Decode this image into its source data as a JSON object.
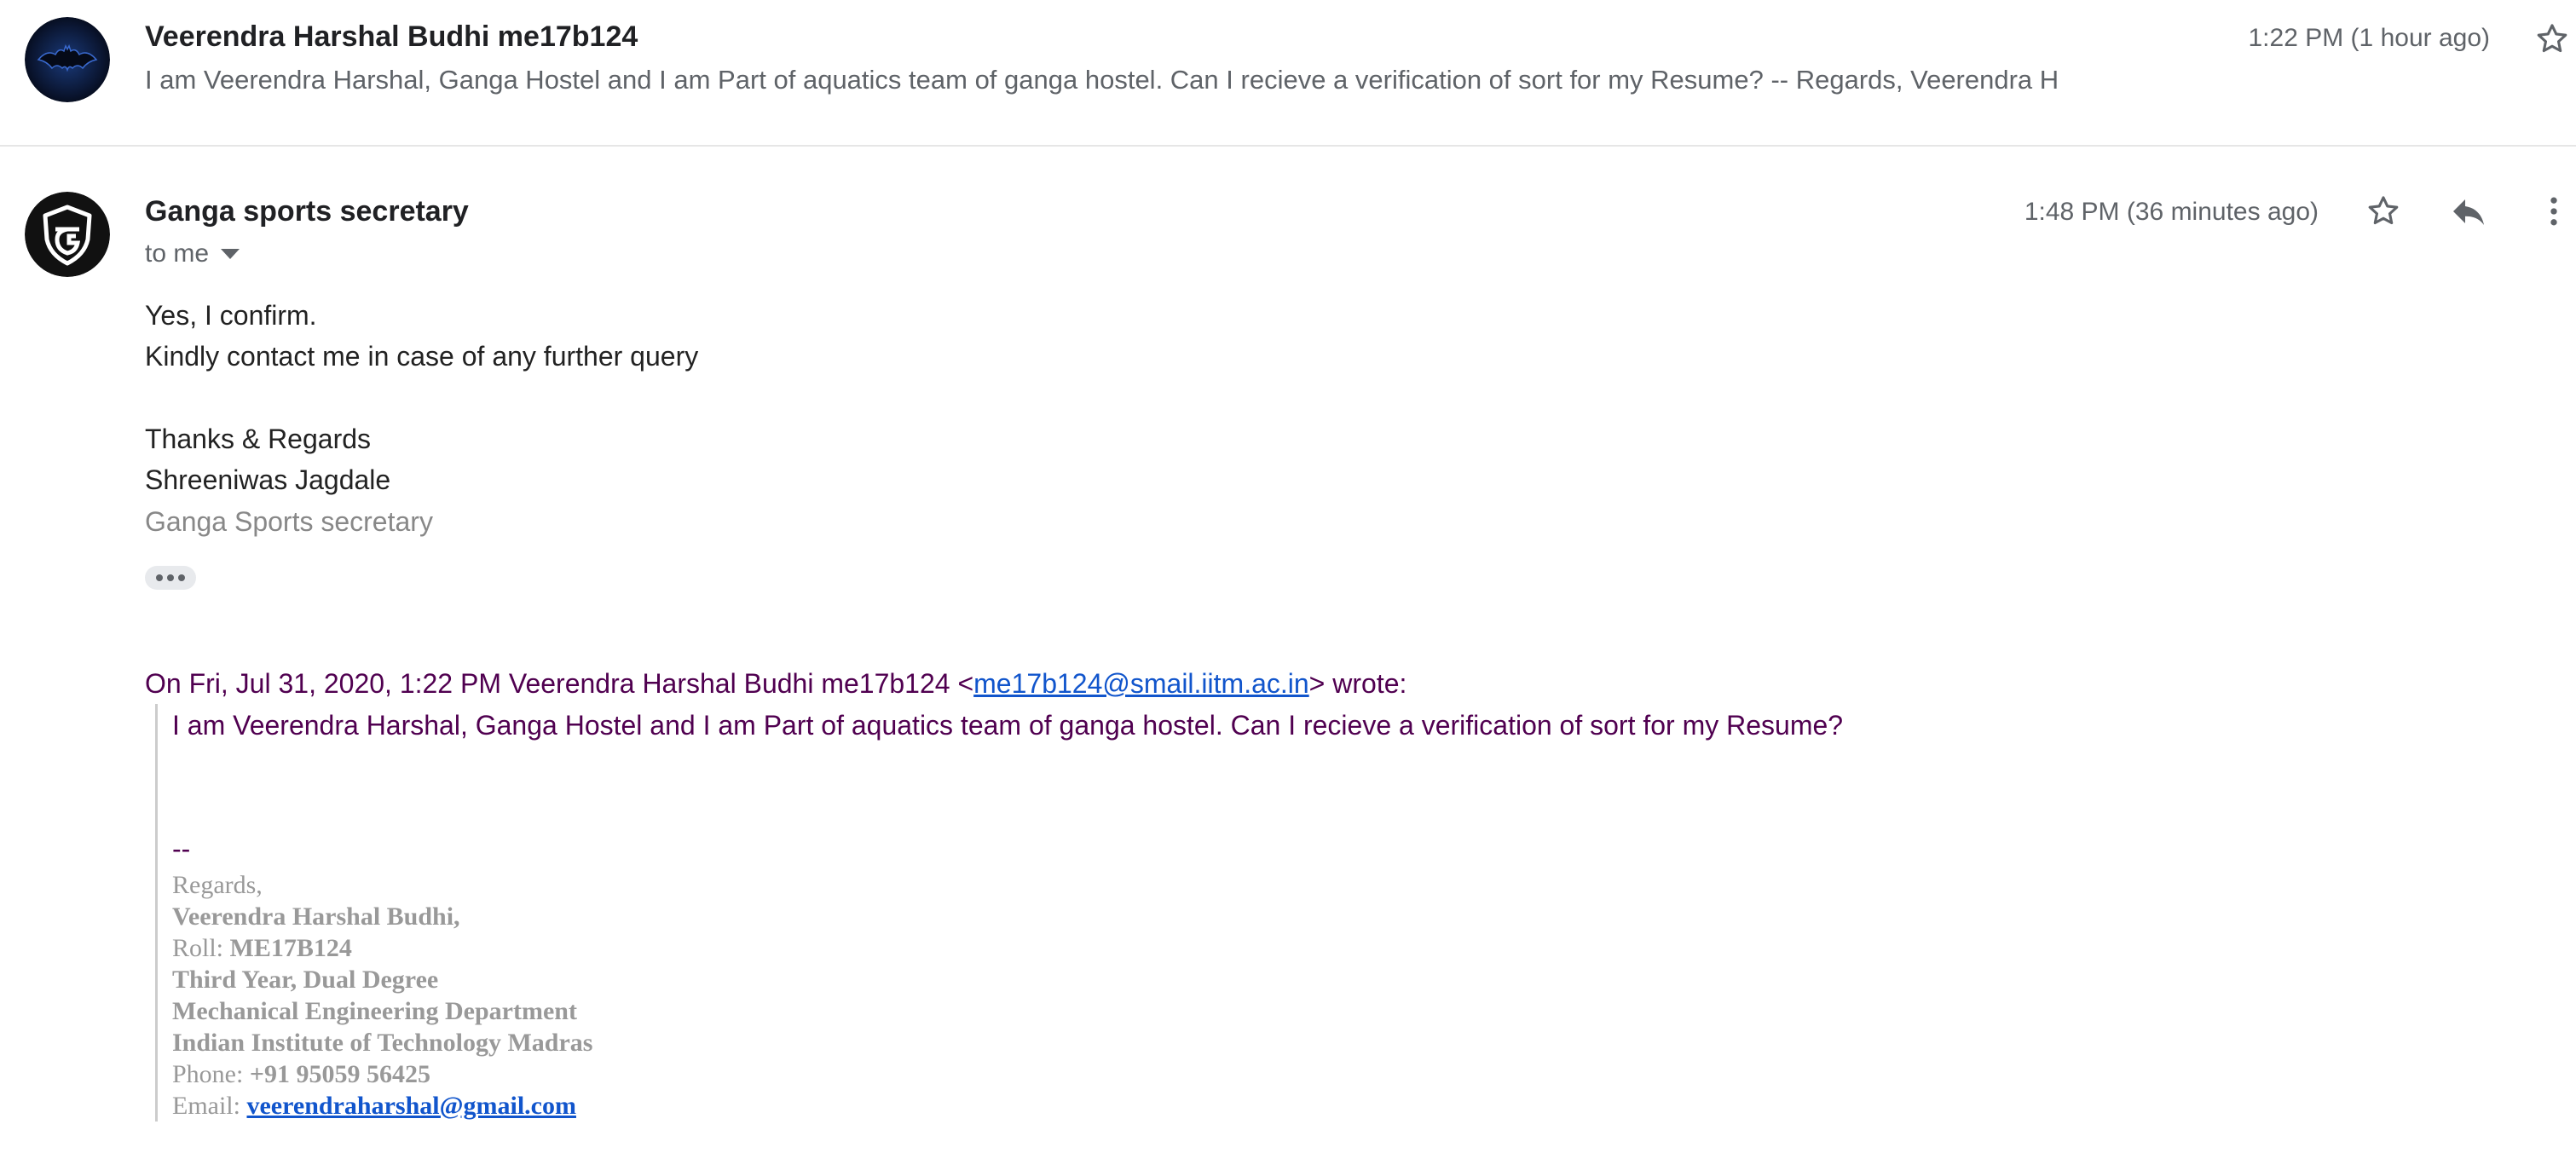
{
  "message1": {
    "sender": "Veerendra Harshal Budhi me17b124",
    "snippet": "I am Veerendra Harshal, Ganga Hostel and I am Part of aquatics team of ganga hostel. Can I recieve a verification of sort for my Resume? -- Regards, Veerendra H",
    "time": "1:22 PM (1 hour ago)",
    "avatar_icon": "batman-logo-icon",
    "star_icon": "star-outline-icon"
  },
  "message2": {
    "sender": "Ganga sports secretary",
    "recipient": "to me",
    "time": "1:48 PM (36 minutes ago)",
    "avatar_icon": "ganga-shield-logo-icon",
    "body": {
      "line1": "Yes, I confirm.",
      "line2": "Kindly contact me in case of any further query",
      "line3": "Thanks & Regards",
      "line4": "Shreeniwas Jagdale",
      "line5": "Ganga Sports secretary"
    },
    "quote": {
      "intro_prefix": "On Fri, Jul 31, 2020, 1:22 PM Veerendra Harshal Budhi me17b124 <",
      "email": "me17b124@smail.iitm.ac.in",
      "intro_suffix": "> wrote:",
      "text": "I am Veerendra Harshal, Ganga Hostel and I am Part of aquatics team of ganga hostel. Can I recieve a verification of sort for my Resume?",
      "dashes": "--"
    },
    "signature": {
      "regards": "Regards,",
      "name": "Veerendra Harshal Budhi,",
      "roll_label": "Roll: ",
      "roll_value": "ME17B124",
      "year": "Third Year, Dual Degree",
      "department": "Mechanical Engineering Department",
      "institute": "Indian Institute of Technology Madras",
      "phone_label": "Phone: ",
      "phone_value": "+91 95059 56425",
      "email_label": "Email: ",
      "email_value": "veerendraharshal@gmail.com"
    }
  },
  "colors": {
    "quote_purple": "#500050",
    "link_blue": "#1155cc",
    "signature_gray": "#999999"
  }
}
